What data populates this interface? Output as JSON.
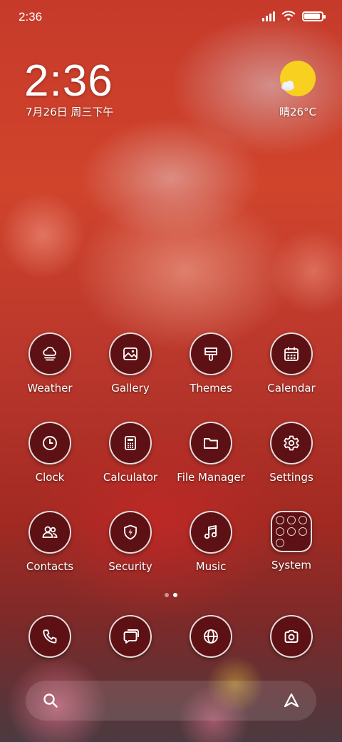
{
  "status_bar": {
    "time": "2:36",
    "battery_level": 0.9
  },
  "clock_widget": {
    "time": "2:36",
    "date": "7月26日 周三下午"
  },
  "weather_widget": {
    "text": "晴26°C",
    "icon": "sun-cloud-icon"
  },
  "apps": [
    {
      "label": "Weather",
      "icon": "weather-icon"
    },
    {
      "label": "Gallery",
      "icon": "gallery-icon"
    },
    {
      "label": "Themes",
      "icon": "themes-brush-icon"
    },
    {
      "label": "Calendar",
      "icon": "calendar-icon"
    },
    {
      "label": "Clock",
      "icon": "clock-icon"
    },
    {
      "label": "Calculator",
      "icon": "calculator-icon"
    },
    {
      "label": "File Manager",
      "icon": "folder-icon"
    },
    {
      "label": "Settings",
      "icon": "gear-icon"
    },
    {
      "label": "Contacts",
      "icon": "contacts-icon"
    },
    {
      "label": "Security",
      "icon": "shield-bolt-icon"
    },
    {
      "label": "Music",
      "icon": "music-note-icon"
    },
    {
      "label": "System",
      "icon": "folder-grid-icon"
    }
  ],
  "dock": [
    {
      "icon": "phone-icon"
    },
    {
      "icon": "messages-icon"
    },
    {
      "icon": "browser-globe-icon"
    },
    {
      "icon": "camera-icon"
    }
  ],
  "page_indicator": {
    "current_page": 2,
    "total_pages": 2
  },
  "colors": {
    "icon_background": "#5e1114",
    "icon_border": "#ffffff",
    "weather_sun": "#f7d020"
  }
}
